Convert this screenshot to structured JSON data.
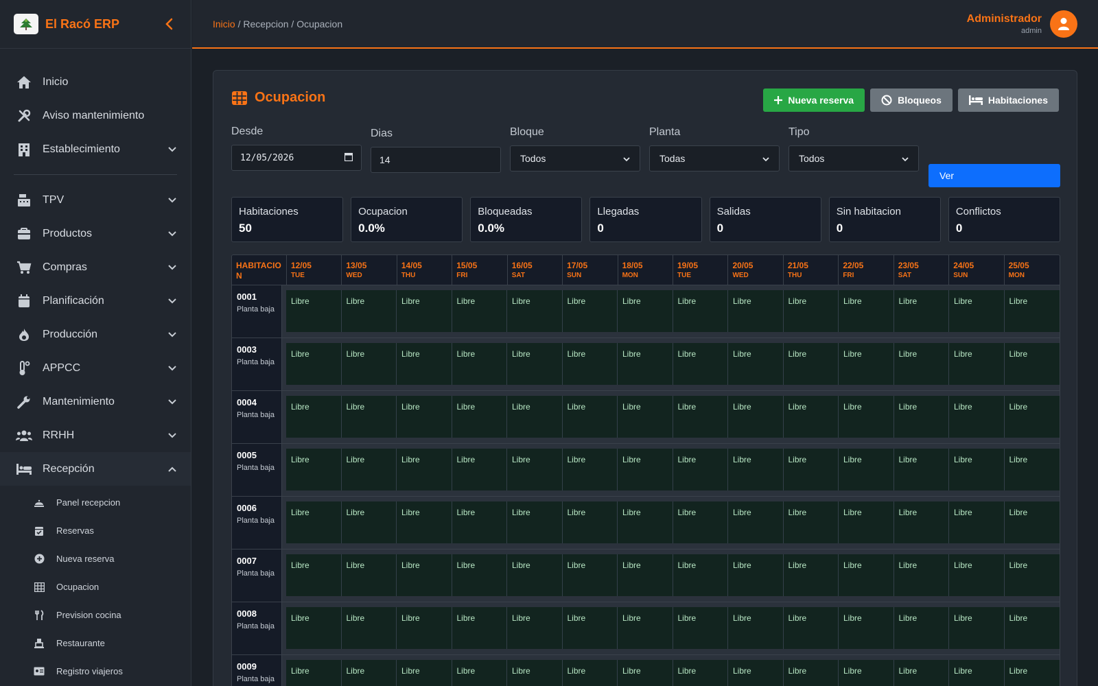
{
  "brand": {
    "name": "El Racó ERP"
  },
  "breadcrumb": {
    "home": "Inicio",
    "sep1": " / ",
    "section": "Recepcion",
    "sep2": " / ",
    "page": "Ocupacion"
  },
  "user": {
    "name": "Administrador",
    "role": "admin"
  },
  "sidebar": {
    "items": [
      {
        "label": "Inicio",
        "icon": "home-icon"
      },
      {
        "label": "Aviso mantenimiento",
        "icon": "tools-icon"
      },
      {
        "label": "Establecimiento",
        "icon": "building-icon"
      },
      {
        "label": "TPV",
        "icon": "cash-register-icon"
      },
      {
        "label": "Productos",
        "icon": "box-icon"
      },
      {
        "label": "Compras",
        "icon": "cart-icon"
      },
      {
        "label": "Planificación",
        "icon": "calendar-icon"
      },
      {
        "label": "Producción",
        "icon": "fire-icon"
      },
      {
        "label": "APPCC",
        "icon": "thermometer-icon"
      },
      {
        "label": "Mantenimiento",
        "icon": "wrench-icon"
      },
      {
        "label": "RRHH",
        "icon": "users-icon"
      },
      {
        "label": "Recepción",
        "icon": "bed-icon"
      }
    ],
    "sub_items": [
      {
        "label": "Panel recepcion",
        "icon": "bell-icon"
      },
      {
        "label": "Reservas",
        "icon": "calendar-check-icon"
      },
      {
        "label": "Nueva reserva",
        "icon": "plus-circle-icon"
      },
      {
        "label": "Ocupacion",
        "icon": "table-icon"
      },
      {
        "label": "Prevision cocina",
        "icon": "utensils-icon"
      },
      {
        "label": "Restaurante",
        "icon": "cloche-icon"
      },
      {
        "label": "Registro viajeros",
        "icon": "id-card-icon"
      }
    ]
  },
  "page": {
    "title": "Ocupacion"
  },
  "actions": {
    "new_booking": "Nueva reserva",
    "blocks": "Bloqueos",
    "rooms": "Habitaciones",
    "view": "Ver"
  },
  "filters": {
    "desde": {
      "label": "Desde",
      "value": "12/05/2026"
    },
    "dias": {
      "label": "Dias",
      "value": "14"
    },
    "bloque": {
      "label": "Bloque",
      "value": "Todos"
    },
    "planta": {
      "label": "Planta",
      "value": "Todas"
    },
    "tipo": {
      "label": "Tipo",
      "value": "Todos"
    }
  },
  "stats": [
    {
      "label": "Habitaciones",
      "value": "50"
    },
    {
      "label": "Ocupacion",
      "value": "0.0%"
    },
    {
      "label": "Bloqueadas",
      "value": "0.0%"
    },
    {
      "label": "Llegadas",
      "value": "0"
    },
    {
      "label": "Salidas",
      "value": "0"
    },
    {
      "label": "Sin habitacion",
      "value": "0"
    },
    {
      "label": "Conflictos",
      "value": "0"
    }
  ],
  "grid": {
    "room_header": "HABITACION",
    "days": [
      {
        "date": "12/05",
        "day": "TUE"
      },
      {
        "date": "13/05",
        "day": "WED"
      },
      {
        "date": "14/05",
        "day": "THU"
      },
      {
        "date": "15/05",
        "day": "FRI"
      },
      {
        "date": "16/05",
        "day": "SAT"
      },
      {
        "date": "17/05",
        "day": "SUN"
      },
      {
        "date": "18/05",
        "day": "MON"
      },
      {
        "date": "19/05",
        "day": "TUE"
      },
      {
        "date": "20/05",
        "day": "WED"
      },
      {
        "date": "21/05",
        "day": "THU"
      },
      {
        "date": "22/05",
        "day": "FRI"
      },
      {
        "date": "23/05",
        "day": "SAT"
      },
      {
        "date": "24/05",
        "day": "SUN"
      },
      {
        "date": "25/05",
        "day": "MON"
      }
    ],
    "free_label": "Libre",
    "rooms": [
      {
        "number": "0001",
        "floor": "Planta baja"
      },
      {
        "number": "0003",
        "floor": "Planta baja"
      },
      {
        "number": "0004",
        "floor": "Planta baja"
      },
      {
        "number": "0005",
        "floor": "Planta baja"
      },
      {
        "number": "0006",
        "floor": "Planta baja"
      },
      {
        "number": "0007",
        "floor": "Planta baja"
      },
      {
        "number": "0008",
        "floor": "Planta baja"
      },
      {
        "number": "0009",
        "floor": "Planta baja"
      }
    ]
  },
  "colors": {
    "accent": "#f97316",
    "green": "#28a745",
    "gray": "#6c757d",
    "blue": "#0d6efd"
  }
}
